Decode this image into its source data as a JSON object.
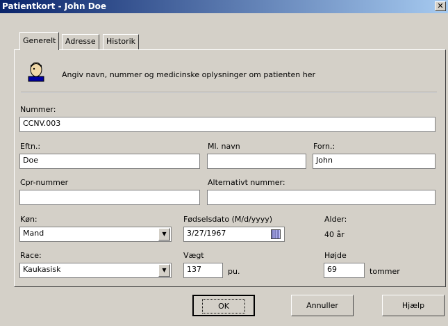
{
  "window": {
    "title": "Patientkort - John Doe"
  },
  "tabs": [
    {
      "label": "Generelt"
    },
    {
      "label": "Adresse"
    },
    {
      "label": "Historik"
    }
  ],
  "intro": {
    "text": "Angiv navn, nummer og medicinske oplysninger om patienten her"
  },
  "fields": {
    "nummer": {
      "label": "Nummer:",
      "value": "CCNV.003"
    },
    "efternavn": {
      "label": "Eftn.:",
      "value": "Doe"
    },
    "mellemnavn": {
      "label": "Ml. navn",
      "value": ""
    },
    "fornavn": {
      "label": "Forn.:",
      "value": "John"
    },
    "cpr": {
      "label": "Cpr-nummer",
      "value": ""
    },
    "alt_nummer": {
      "label": "Alternativt nummer:",
      "value": ""
    },
    "koen": {
      "label": "Køn:",
      "value": "Mand"
    },
    "foedselsdato": {
      "label": "Fødselsdato  (M/d/yyyy)",
      "value": "3/27/1967"
    },
    "alder": {
      "label": "Alder:",
      "value": "40 år"
    },
    "race": {
      "label": "Race:",
      "value": "Kaukasisk"
    },
    "vaegt": {
      "label": "Vægt",
      "value": "137",
      "unit": "pu."
    },
    "hoejde": {
      "label": "Højde",
      "value": "69",
      "unit": "tommer"
    }
  },
  "buttons": {
    "ok": "OK",
    "cancel": "Annuller",
    "help": "Hjælp"
  },
  "icons": {
    "patient": "patient-head-icon",
    "close": "close-icon",
    "dropdown": "chevron-down-icon",
    "calendar": "calendar-icon"
  }
}
